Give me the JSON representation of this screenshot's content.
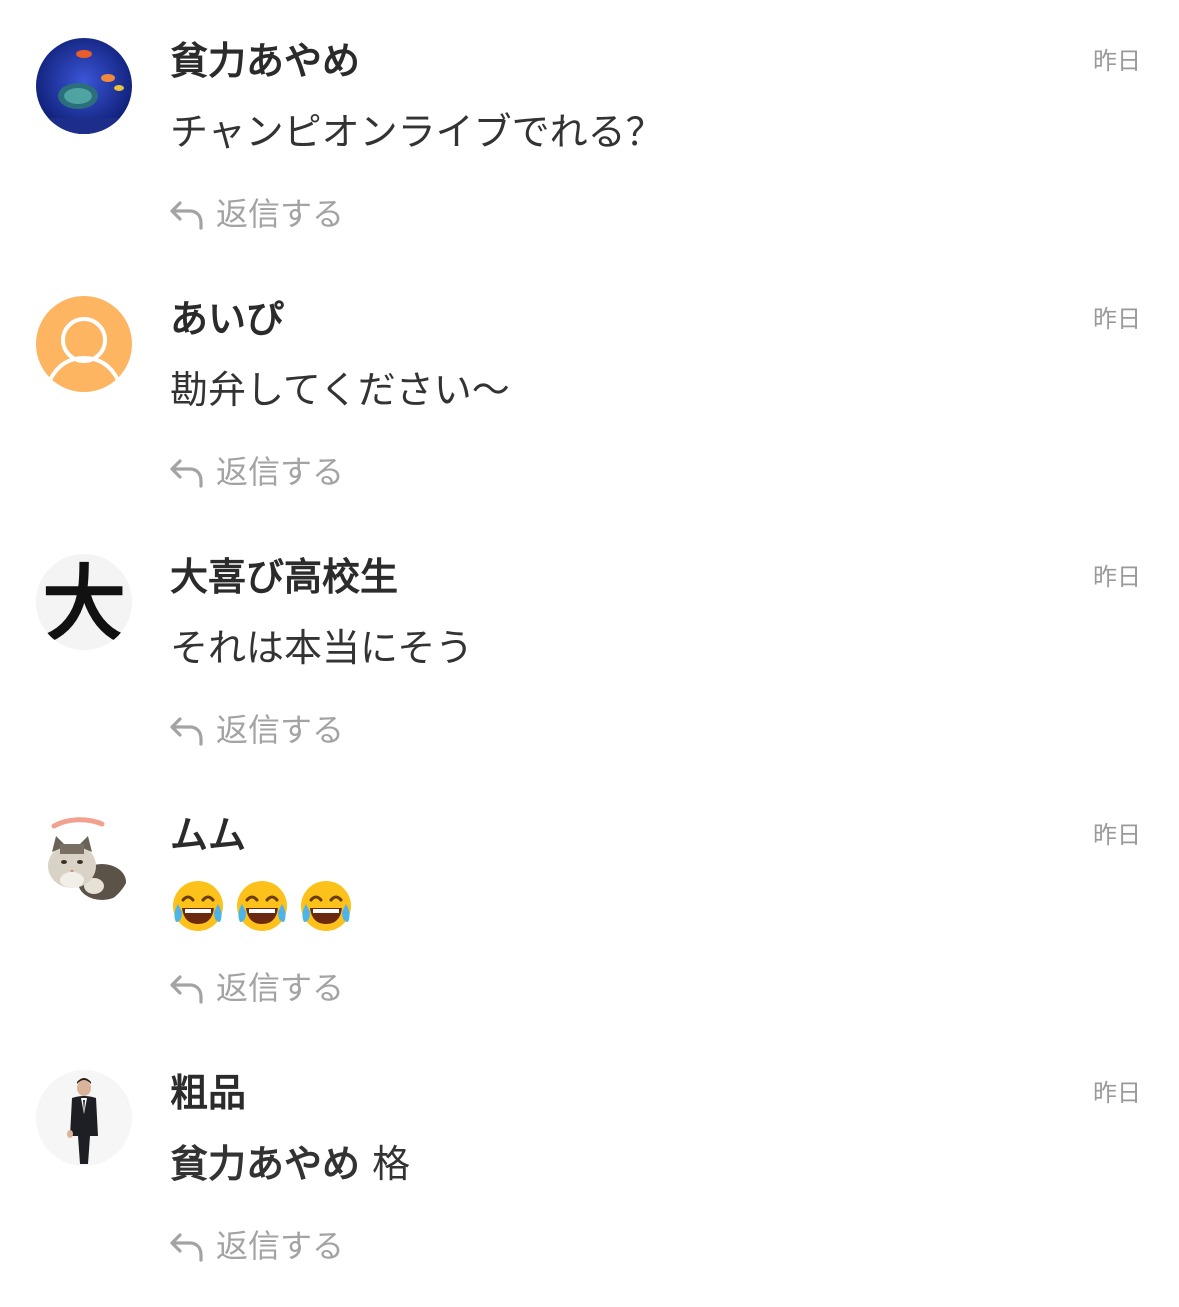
{
  "comments": [
    {
      "name": "貧力あやめ",
      "time": "昨日",
      "text": "チャンピオンライブでれる？",
      "reply_label": "返信する",
      "avatar": "aquarium-avatar"
    },
    {
      "name": "あいぴ",
      "time": "昨日",
      "text": "勘弁してください〜",
      "reply_label": "返信する",
      "avatar": "default-user-avatar"
    },
    {
      "name": "大喜び高校生",
      "time": "昨日",
      "text": "それは本当にそう",
      "reply_label": "返信する",
      "avatar": "kanji-avatar",
      "avatar_char": "大"
    },
    {
      "name": "ムム",
      "time": "昨日",
      "emojis": [
        "face-with-tears-of-joy",
        "face-with-tears-of-joy",
        "face-with-tears-of-joy"
      ],
      "reply_label": "返信する",
      "avatar": "cat-avatar"
    },
    {
      "name": "粗品",
      "time": "昨日",
      "mention": "貧力あやめ",
      "text": "格",
      "reply_label": "返信する",
      "avatar": "man-in-suit-avatar"
    }
  ],
  "colors": {
    "name": "#2b2b2b",
    "meta": "#9a9a9a",
    "default_avatar": "#fdb562"
  }
}
